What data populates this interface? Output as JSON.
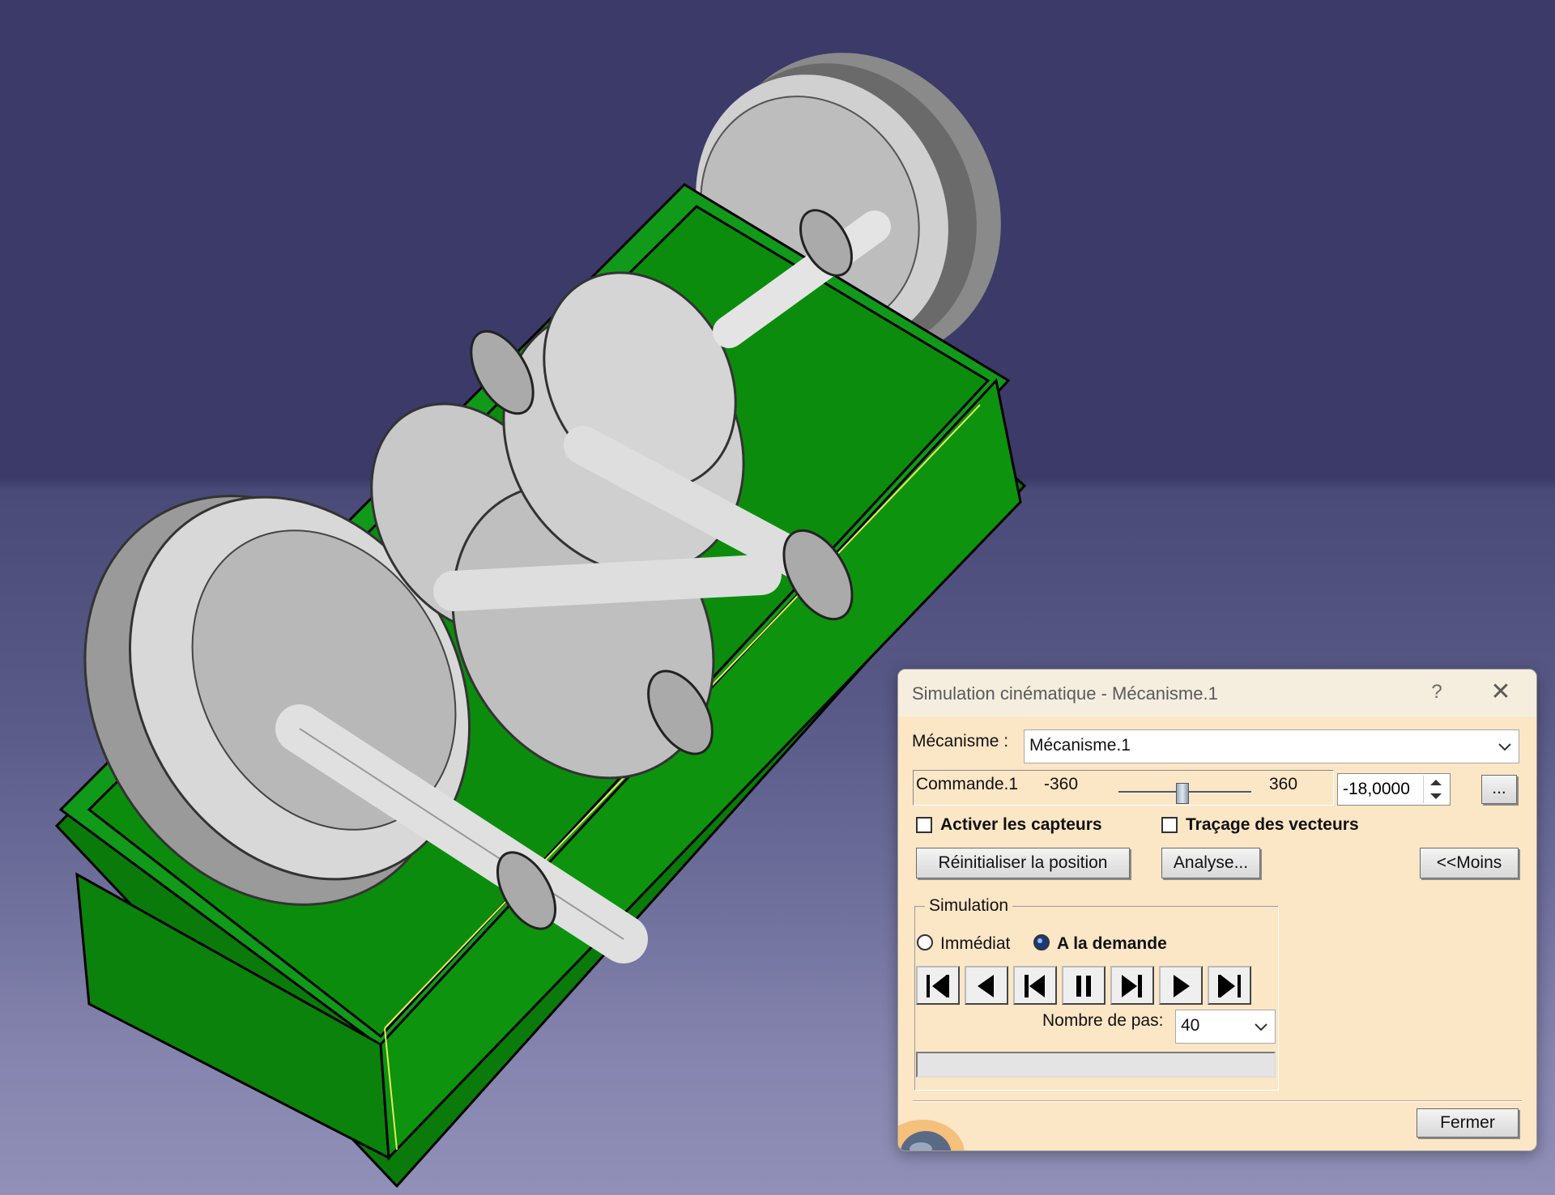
{
  "dialog": {
    "title": "Simulation cinématique - Mécanisme.1",
    "help_label": "?",
    "close_label": "✕",
    "mechanism_label": "Mécanisme :",
    "mechanism_value": "Mécanisme.1",
    "command_name": "Commande.1",
    "command_min": "-360",
    "command_max": "360",
    "command_value": "-18,0000",
    "command_fraction": 0.475,
    "ellipsis_label": "...",
    "activate_sensors_label": "Activer les capteurs",
    "activate_sensors_checked": false,
    "vector_trace_label": "Traçage des vecteurs",
    "vector_trace_checked": false,
    "reset_label": "Réinitialiser la position",
    "analysis_label": "Analyse...",
    "less_label": "<<Moins",
    "simulation_group_label": "Simulation",
    "immediate_label": "Immédiat",
    "on_demand_label": "A la demande",
    "selected_mode": "on_demand",
    "steps_label": "Nombre de pas:",
    "steps_value": "40",
    "progress": 0,
    "close_button_label": "Fermer",
    "media_buttons": [
      "jump-to-start",
      "step-back",
      "play-backward",
      "pause",
      "play-forward",
      "step-forward",
      "jump-to-end"
    ]
  },
  "colors": {
    "background": "#3b3a68",
    "housing": "#0c8c0c",
    "gears": "#c8c8c8",
    "dialog_bg": "#fbe6c6"
  }
}
